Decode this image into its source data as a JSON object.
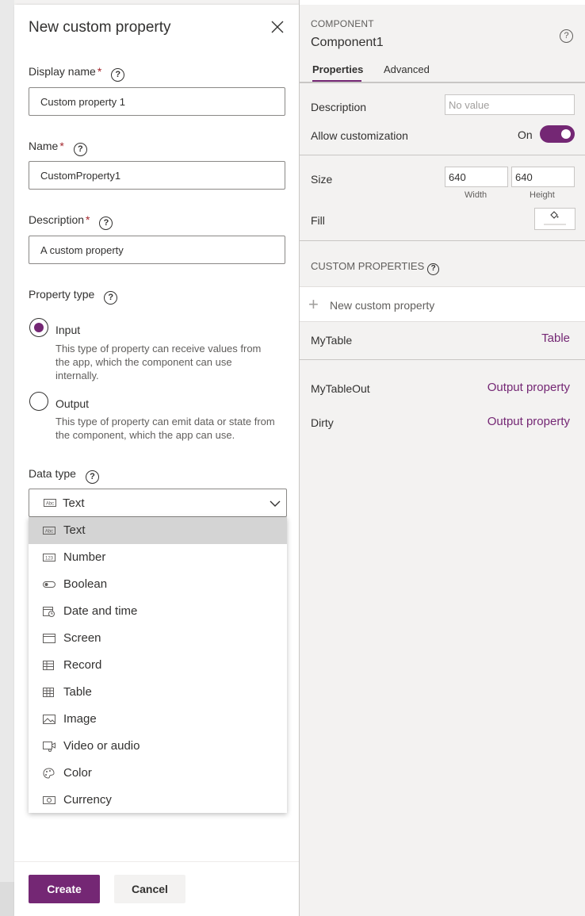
{
  "dialog": {
    "title": "New custom property",
    "display_name": {
      "label": "Display name",
      "value": "Custom property 1"
    },
    "name": {
      "label": "Name",
      "value": "CustomProperty1"
    },
    "description": {
      "label": "Description",
      "value": "A custom property"
    },
    "required_mark": "*",
    "help_glyph": "?",
    "property_type": {
      "label": "Property type",
      "options": [
        {
          "label": "Input",
          "desc": "This type of property can receive values from the app, which the component can use internally.",
          "checked": true
        },
        {
          "label": "Output",
          "desc": "This type of property can emit data or state from the component, which the app can use.",
          "checked": false
        }
      ]
    },
    "data_type": {
      "label": "Data type",
      "selected": "Text",
      "options": [
        "Text",
        "Number",
        "Boolean",
        "Date and time",
        "Screen",
        "Record",
        "Table",
        "Image",
        "Video or audio",
        "Color",
        "Currency"
      ],
      "icons": [
        "abc-icon",
        "number-icon",
        "toggle-icon",
        "calendar-icon",
        "screen-icon",
        "record-icon",
        "table-icon",
        "image-icon",
        "video-icon",
        "palette-icon",
        "currency-icon"
      ]
    },
    "buttons": {
      "create": "Create",
      "cancel": "Cancel"
    }
  },
  "right_panel": {
    "kicker": "COMPONENT",
    "component_name": "Component1",
    "tabs": [
      "Properties",
      "Advanced"
    ],
    "description_label": "Description",
    "description_placeholder": "No value",
    "allow_customization_label": "Allow customization",
    "allow_customization_state": "On",
    "size_label": "Size",
    "width_value": "640",
    "height_value": "640",
    "width_caption": "Width",
    "height_caption": "Height",
    "fill_label": "Fill",
    "custom_properties_heading": "CUSTOM PROPERTIES",
    "new_custom_property": "New custom property",
    "properties": [
      {
        "name": "MyTable",
        "type": "Table"
      },
      {
        "name": "MyTableOut",
        "type": "Output property"
      },
      {
        "name": "Dirty",
        "type": "Output property"
      }
    ]
  },
  "colors": {
    "accent": "#742774",
    "required": "#a4262c"
  }
}
